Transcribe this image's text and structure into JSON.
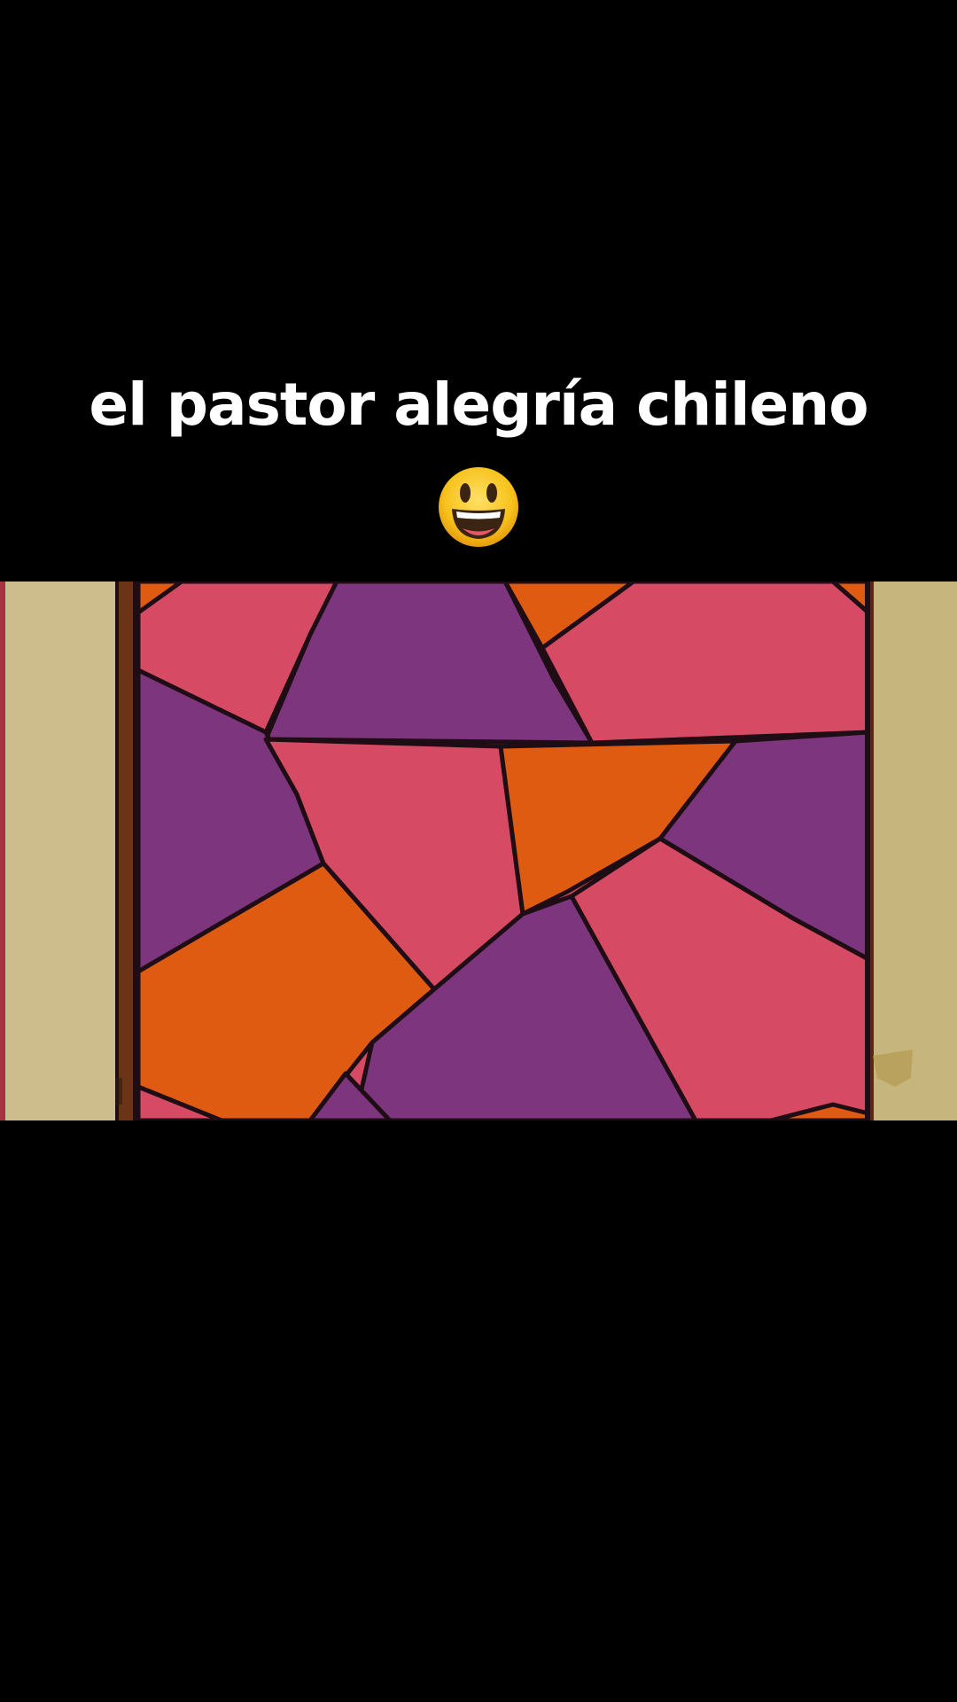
{
  "caption": {
    "text": "el pastor alegría chileno",
    "emoji": "grinning-face-icon"
  },
  "video": {
    "scene": "stained-glass-window",
    "colors": {
      "pink": "#d64a63",
      "purple": "#7d357d",
      "orange": "#df5b12",
      "wall": "#cbb98a",
      "frame": "#6b3417",
      "lead": "#1e0d14"
    }
  }
}
